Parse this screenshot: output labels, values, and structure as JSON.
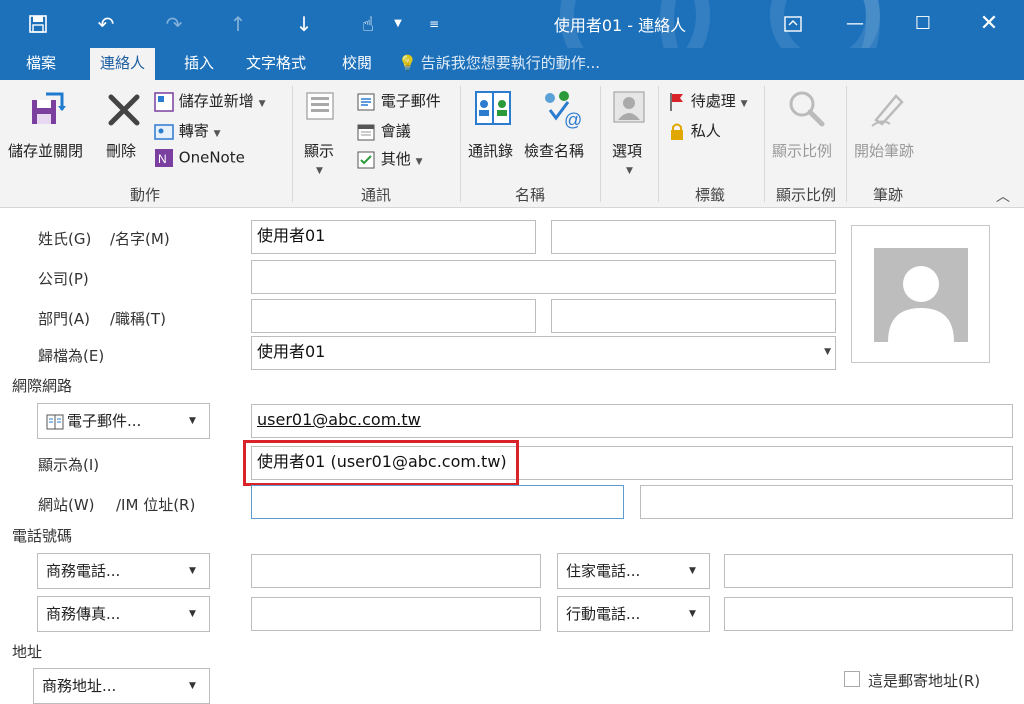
{
  "window": {
    "title": "使用者01 - 連絡人",
    "qat": [
      "save-icon",
      "undo-icon",
      "redo-icon",
      "up-icon",
      "down-icon",
      "touch-mode-icon",
      "customize-icon"
    ]
  },
  "tabs": [
    {
      "label": "檔案",
      "active": false
    },
    {
      "label": "連絡人",
      "active": true
    },
    {
      "label": "插入",
      "active": false
    },
    {
      "label": "文字格式",
      "active": false
    },
    {
      "label": "校閱",
      "active": false
    }
  ],
  "tell_me": "告訴我您想要執行的動作...",
  "ribbon": {
    "groups": {
      "actions": "動作",
      "communicate": "通訊",
      "names": "名稱",
      "tags": "標籤",
      "zoom": "顯示比例",
      "ink": "筆跡"
    },
    "save_close": "儲存並關閉",
    "delete": "刪除",
    "save_new": "儲存並新增",
    "forward": "轉寄",
    "onenote": "OneNote",
    "show": "顯示",
    "email": "電子郵件",
    "meeting": "會議",
    "more": "其他",
    "address_book": "通訊錄",
    "check_names": "檢查名稱",
    "options": "選項",
    "follow_up": "待處理",
    "private": "私人",
    "zoom": "顯示比例",
    "start_inking": "開始筆跡"
  },
  "form": {
    "name_label_last": "姓氏(G)",
    "name_label_first": "/名字(M)",
    "last_name": "使用者01",
    "first_name": "",
    "company_label": "公司(P)",
    "company": "",
    "dept_label": "部門(A)",
    "title_label": "/職稱(T)",
    "department": "",
    "job_title": "",
    "file_as_label": "歸檔為(E)",
    "file_as": "使用者01",
    "internet_section": "網際網路",
    "email_button": "電子郵件...",
    "email": "user01@abc.com.tw",
    "display_as_label": "顯示為(I)",
    "display_as": "使用者01 (user01@abc.com.tw)",
    "web_label": "網站(W)",
    "im_label": "/IM 位址(R)",
    "web": "",
    "im": "",
    "phone_section": "電話號碼",
    "business_phone_btn": "商務電話...",
    "home_phone_btn": "住家電話...",
    "business_fax_btn": "商務傳真...",
    "mobile_phone_btn": "行動電話...",
    "business_phone": "",
    "home_phone": "",
    "business_fax": "",
    "mobile_phone": "",
    "address_section": "地址",
    "business_address_btn": "商務地址...",
    "mailing_address_label": "這是郵寄地址(R)",
    "mailing_address_checked": false
  },
  "colors": {
    "titlebar": "#1d71bb",
    "highlight": "#d8232a",
    "focus_border": "#5d9bd1"
  }
}
